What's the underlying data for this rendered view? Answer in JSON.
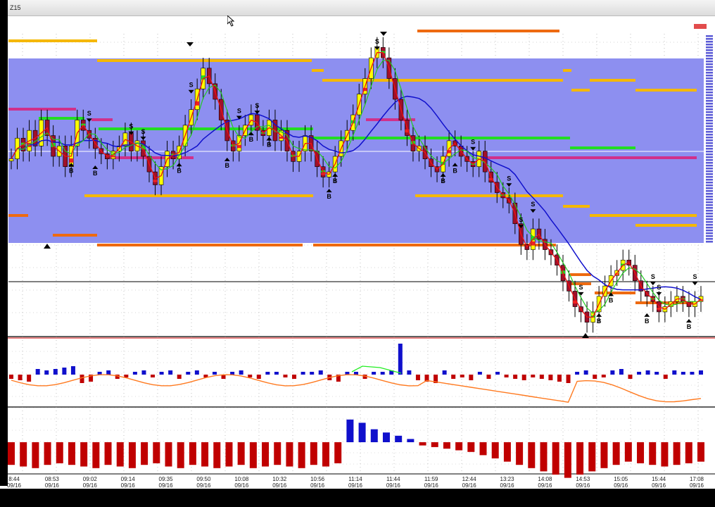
{
  "window": {
    "title": "Z15"
  },
  "colors": {
    "range_box": "#8d8ff0",
    "bull_bar": "#ffff00",
    "bear_bar": "#a0102a",
    "neutral_bar": "#ee2222",
    "green_bar": "#22dd22",
    "ma_fast": "#ee1111",
    "ma_mid": "#22cc22",
    "ma_slow": "#1010cc",
    "level_gold": "#f5b800",
    "level_orange": "#ee6a10",
    "level_magenta": "#d0308a",
    "level_green": "#22dd22",
    "volume_pos": "#1010cc",
    "volume_neg": "#c00000",
    "volume_line": "#ff7a20",
    "volume_line_alt": "#22ee22"
  },
  "chart_data": [
    {
      "type": "candlestick",
      "title": "",
      "x_labels": [
        {
          "time": "8:44",
          "date": "09/16"
        },
        {
          "time": "08:53",
          "date": "09/16"
        },
        {
          "time": "09:02",
          "date": "09/16"
        },
        {
          "time": "09:14",
          "date": "09/16"
        },
        {
          "time": "09:35",
          "date": "09/16"
        },
        {
          "time": "09:50",
          "date": "09/16"
        },
        {
          "time": "10:08",
          "date": "09/16"
        },
        {
          "time": "10:32",
          "date": "09/16"
        },
        {
          "time": "10:56",
          "date": "09/16"
        },
        {
          "time": "11:14",
          "date": "09/16"
        },
        {
          "time": "11:44",
          "date": "09/16"
        },
        {
          "time": "11:59",
          "date": "09/16"
        },
        {
          "time": "12:44",
          "date": "09/16"
        },
        {
          "time": "13:23",
          "date": "09/16"
        },
        {
          "time": "14:08",
          "date": "09/16"
        },
        {
          "time": "14:53",
          "date": "09/16"
        },
        {
          "time": "15:05",
          "date": "09/16"
        },
        {
          "time": "15:44",
          "date": "09/16"
        },
        {
          "time": "17:08",
          "date": "09/16"
        }
      ],
      "close_series": [
        55,
        63,
        58,
        66,
        60,
        70,
        64,
        56,
        60,
        52,
        60,
        70,
        66,
        63,
        59,
        57,
        55,
        58,
        60,
        65,
        58,
        62,
        56,
        50,
        45,
        52,
        58,
        55,
        60,
        68,
        74,
        82,
        90,
        84,
        78,
        70,
        62,
        58,
        64,
        68,
        72,
        66,
        64,
        70,
        62,
        66,
        58,
        54,
        58,
        64,
        58,
        52,
        48,
        50,
        56,
        62,
        66,
        72,
        80,
        86,
        94,
        98,
        94,
        86,
        78,
        70,
        64,
        58,
        60,
        55,
        52,
        50,
        56,
        62,
        60,
        56,
        54,
        52,
        58,
        50,
        46,
        42,
        40,
        38,
        30,
        22,
        20,
        28,
        24,
        20,
        18,
        14,
        8,
        4,
        -2,
        -4,
        -8,
        -4,
        2,
        6,
        10,
        12,
        16,
        14,
        8,
        4,
        2,
        0,
        -4,
        -2,
        0,
        2,
        0,
        -2,
        0,
        2
      ],
      "markers": [
        {
          "label": "S",
          "at": 0.11
        },
        {
          "label": "B",
          "at": 0.09
        },
        {
          "label": "S",
          "at": 0.17
        },
        {
          "label": "B",
          "at": 0.12
        },
        {
          "label": "S",
          "at": 0.19
        },
        {
          "label": "S",
          "at": 0.26
        },
        {
          "label": "B",
          "at": 0.24
        },
        {
          "label": "S",
          "at": 0.33
        },
        {
          "label": "B",
          "at": 0.31
        },
        {
          "label": "S",
          "at": 0.36
        },
        {
          "label": "B",
          "at": 0.35
        },
        {
          "label": "B",
          "at": 0.37
        },
        {
          "label": "B",
          "at": 0.46
        },
        {
          "label": "S",
          "at": 0.53
        },
        {
          "label": "B",
          "at": 0.47
        },
        {
          "label": "B",
          "at": 0.63
        },
        {
          "label": "S",
          "at": 0.67
        },
        {
          "label": "B",
          "at": 0.64
        },
        {
          "label": "S",
          "at": 0.72
        },
        {
          "label": "S",
          "at": 0.74
        },
        {
          "label": "S",
          "at": 0.76
        },
        {
          "label": "S",
          "at": 0.83
        },
        {
          "label": "B",
          "at": 0.85
        },
        {
          "label": "B",
          "at": 0.87
        },
        {
          "label": "S",
          "at": 0.93
        },
        {
          "label": "B",
          "at": 0.92
        },
        {
          "label": "S",
          "at": 0.94
        },
        {
          "label": "B",
          "at": 0.98
        },
        {
          "label": "S",
          "at": 0.99
        }
      ]
    },
    {
      "type": "bar",
      "title": "",
      "values": [
        -3,
        -4,
        -5,
        4,
        3,
        4,
        5,
        6,
        -6,
        -5,
        2,
        3,
        -3,
        -2,
        2,
        3,
        -2,
        2,
        3,
        -3,
        2,
        3,
        -2,
        2,
        -3,
        2,
        3,
        -2,
        -3,
        2,
        2,
        -2,
        -3,
        2,
        2,
        3,
        -4,
        -5,
        2,
        2,
        -3,
        2,
        2,
        3,
        22,
        3,
        -4,
        -5,
        -6,
        3,
        -3,
        -2,
        -4,
        2,
        -3,
        2,
        -2,
        -3,
        -4,
        -2,
        -3,
        -4,
        -5,
        -6,
        2,
        3,
        -3,
        -2,
        3,
        4,
        -3,
        2,
        3,
        2,
        -3,
        3,
        2,
        2,
        3
      ]
    },
    {
      "type": "bar",
      "title": "",
      "values": [
        -14,
        -15,
        -16,
        -14,
        -13,
        -14,
        -15,
        -16,
        -14,
        -15,
        -16,
        -14,
        -13,
        -15,
        -16,
        -14,
        -15,
        -16,
        -15,
        -14,
        -16,
        -15,
        -14,
        -15,
        -16,
        -14,
        -15,
        -13,
        14,
        12,
        8,
        6,
        4,
        2,
        -2,
        -3,
        -4,
        -5,
        -6,
        -8,
        -10,
        -12,
        -14,
        -16,
        -18,
        -20,
        -22,
        -20,
        -18,
        -16,
        -14,
        -12,
        -13,
        -14,
        -15,
        -14,
        -13,
        -12
      ]
    }
  ]
}
